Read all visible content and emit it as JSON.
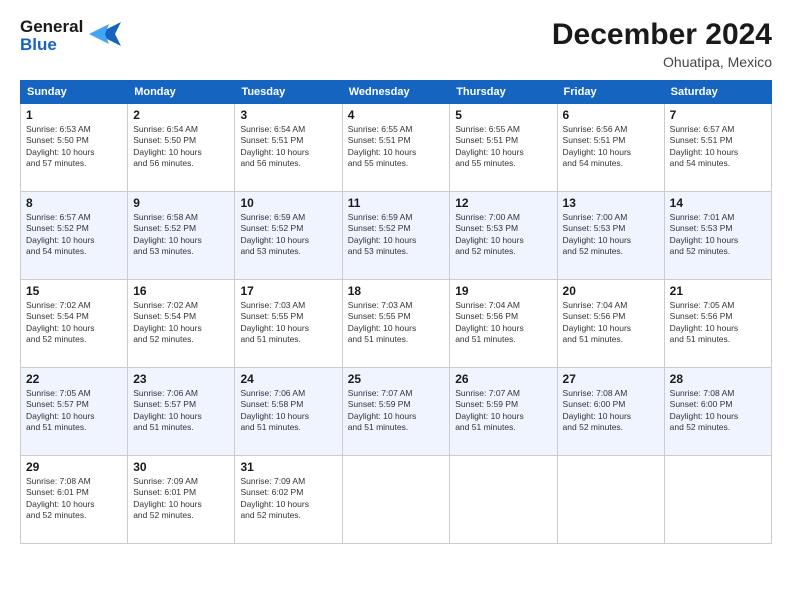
{
  "logo": {
    "line1": "General",
    "line2": "Blue",
    "icon": "▶"
  },
  "title": "December 2024",
  "location": "Ohuatipa, Mexico",
  "days_of_week": [
    "Sunday",
    "Monday",
    "Tuesday",
    "Wednesday",
    "Thursday",
    "Friday",
    "Saturday"
  ],
  "weeks": [
    [
      {
        "day": "1",
        "info": "Sunrise: 6:53 AM\nSunset: 5:50 PM\nDaylight: 10 hours\nand 57 minutes."
      },
      {
        "day": "2",
        "info": "Sunrise: 6:54 AM\nSunset: 5:50 PM\nDaylight: 10 hours\nand 56 minutes."
      },
      {
        "day": "3",
        "info": "Sunrise: 6:54 AM\nSunset: 5:51 PM\nDaylight: 10 hours\nand 56 minutes."
      },
      {
        "day": "4",
        "info": "Sunrise: 6:55 AM\nSunset: 5:51 PM\nDaylight: 10 hours\nand 55 minutes."
      },
      {
        "day": "5",
        "info": "Sunrise: 6:55 AM\nSunset: 5:51 PM\nDaylight: 10 hours\nand 55 minutes."
      },
      {
        "day": "6",
        "info": "Sunrise: 6:56 AM\nSunset: 5:51 PM\nDaylight: 10 hours\nand 54 minutes."
      },
      {
        "day": "7",
        "info": "Sunrise: 6:57 AM\nSunset: 5:51 PM\nDaylight: 10 hours\nand 54 minutes."
      }
    ],
    [
      {
        "day": "8",
        "info": "Sunrise: 6:57 AM\nSunset: 5:52 PM\nDaylight: 10 hours\nand 54 minutes."
      },
      {
        "day": "9",
        "info": "Sunrise: 6:58 AM\nSunset: 5:52 PM\nDaylight: 10 hours\nand 53 minutes."
      },
      {
        "day": "10",
        "info": "Sunrise: 6:59 AM\nSunset: 5:52 PM\nDaylight: 10 hours\nand 53 minutes."
      },
      {
        "day": "11",
        "info": "Sunrise: 6:59 AM\nSunset: 5:52 PM\nDaylight: 10 hours\nand 53 minutes."
      },
      {
        "day": "12",
        "info": "Sunrise: 7:00 AM\nSunset: 5:53 PM\nDaylight: 10 hours\nand 52 minutes."
      },
      {
        "day": "13",
        "info": "Sunrise: 7:00 AM\nSunset: 5:53 PM\nDaylight: 10 hours\nand 52 minutes."
      },
      {
        "day": "14",
        "info": "Sunrise: 7:01 AM\nSunset: 5:53 PM\nDaylight: 10 hours\nand 52 minutes."
      }
    ],
    [
      {
        "day": "15",
        "info": "Sunrise: 7:02 AM\nSunset: 5:54 PM\nDaylight: 10 hours\nand 52 minutes."
      },
      {
        "day": "16",
        "info": "Sunrise: 7:02 AM\nSunset: 5:54 PM\nDaylight: 10 hours\nand 52 minutes."
      },
      {
        "day": "17",
        "info": "Sunrise: 7:03 AM\nSunset: 5:55 PM\nDaylight: 10 hours\nand 51 minutes."
      },
      {
        "day": "18",
        "info": "Sunrise: 7:03 AM\nSunset: 5:55 PM\nDaylight: 10 hours\nand 51 minutes."
      },
      {
        "day": "19",
        "info": "Sunrise: 7:04 AM\nSunset: 5:56 PM\nDaylight: 10 hours\nand 51 minutes."
      },
      {
        "day": "20",
        "info": "Sunrise: 7:04 AM\nSunset: 5:56 PM\nDaylight: 10 hours\nand 51 minutes."
      },
      {
        "day": "21",
        "info": "Sunrise: 7:05 AM\nSunset: 5:56 PM\nDaylight: 10 hours\nand 51 minutes."
      }
    ],
    [
      {
        "day": "22",
        "info": "Sunrise: 7:05 AM\nSunset: 5:57 PM\nDaylight: 10 hours\nand 51 minutes."
      },
      {
        "day": "23",
        "info": "Sunrise: 7:06 AM\nSunset: 5:57 PM\nDaylight: 10 hours\nand 51 minutes."
      },
      {
        "day": "24",
        "info": "Sunrise: 7:06 AM\nSunset: 5:58 PM\nDaylight: 10 hours\nand 51 minutes."
      },
      {
        "day": "25",
        "info": "Sunrise: 7:07 AM\nSunset: 5:59 PM\nDaylight: 10 hours\nand 51 minutes."
      },
      {
        "day": "26",
        "info": "Sunrise: 7:07 AM\nSunset: 5:59 PM\nDaylight: 10 hours\nand 51 minutes."
      },
      {
        "day": "27",
        "info": "Sunrise: 7:08 AM\nSunset: 6:00 PM\nDaylight: 10 hours\nand 52 minutes."
      },
      {
        "day": "28",
        "info": "Sunrise: 7:08 AM\nSunset: 6:00 PM\nDaylight: 10 hours\nand 52 minutes."
      }
    ],
    [
      {
        "day": "29",
        "info": "Sunrise: 7:08 AM\nSunset: 6:01 PM\nDaylight: 10 hours\nand 52 minutes."
      },
      {
        "day": "30",
        "info": "Sunrise: 7:09 AM\nSunset: 6:01 PM\nDaylight: 10 hours\nand 52 minutes."
      },
      {
        "day": "31",
        "info": "Sunrise: 7:09 AM\nSunset: 6:02 PM\nDaylight: 10 hours\nand 52 minutes."
      },
      {
        "day": "",
        "info": ""
      },
      {
        "day": "",
        "info": ""
      },
      {
        "day": "",
        "info": ""
      },
      {
        "day": "",
        "info": ""
      }
    ]
  ]
}
